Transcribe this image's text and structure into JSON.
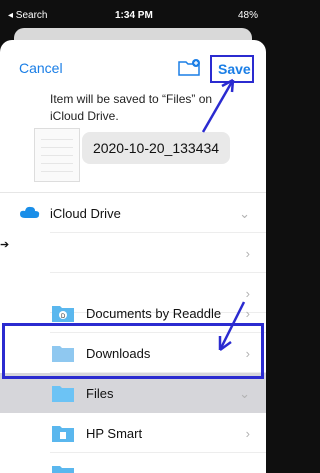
{
  "status": {
    "back_app": "◂ Search",
    "time": "1:34 PM",
    "battery": "48%"
  },
  "nav": {
    "cancel": "Cancel",
    "save": "Save",
    "new_folder_icon": "folder-plus-icon"
  },
  "info": {
    "line1": "Item will be saved to “Files” on",
    "line2": "iCloud Drive."
  },
  "filename": "2020-10-20_133434",
  "locations": [
    {
      "label": "iCloud Drive",
      "icon": "cloud-icon"
    },
    {
      "label": "",
      "icon": ""
    },
    {
      "label": "",
      "icon": ""
    },
    {
      "label": "Documents by Readdle",
      "icon": "folder-icon"
    },
    {
      "label": "Downloads",
      "icon": "folder-icon"
    },
    {
      "label": "Files",
      "icon": "folder-icon"
    },
    {
      "label": "HP Smart",
      "icon": "folder-icon"
    }
  ],
  "colors": {
    "accent": "#1a7ee6",
    "annotation": "#2b2bd0",
    "selected_row": "#d6d6da"
  }
}
